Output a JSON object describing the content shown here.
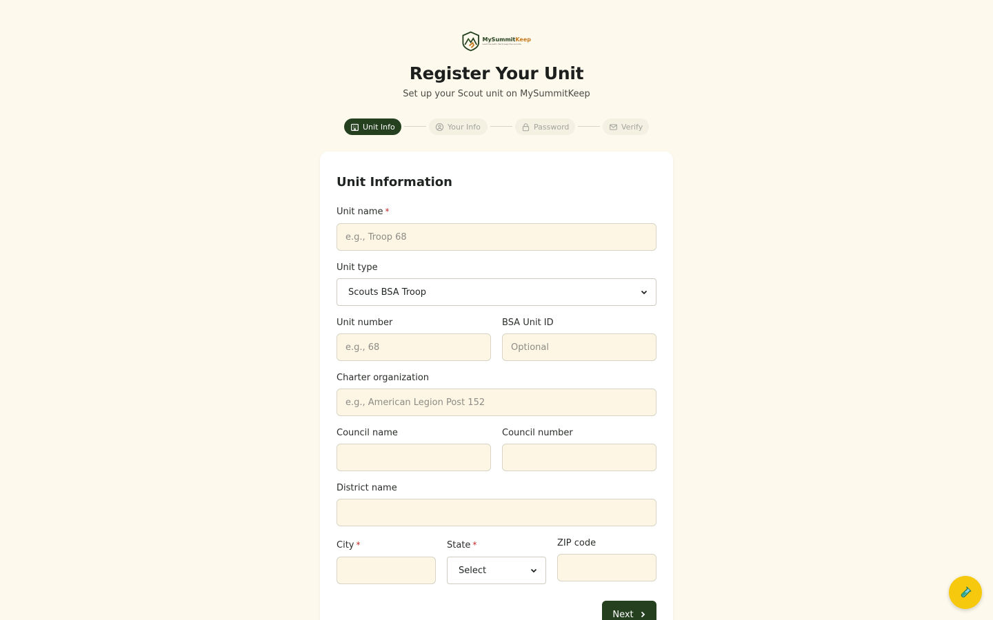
{
  "brand": {
    "name_part1": "MySummit",
    "name_part2": "Keep",
    "tagline": "Lead the path. We'll keep the records."
  },
  "header": {
    "title": "Register Your Unit",
    "subtitle": "Set up your Scout unit on MySummitKeep"
  },
  "steps": [
    {
      "label": "Unit Info",
      "icon": "building-icon",
      "state": "active"
    },
    {
      "label": "Your Info",
      "icon": "user-circle-icon",
      "state": "inactive"
    },
    {
      "label": "Password",
      "icon": "lock-icon",
      "state": "inactive"
    },
    {
      "label": "Verify",
      "icon": "mail-icon",
      "state": "inactive"
    }
  ],
  "form": {
    "section_title": "Unit Information",
    "unit_name": {
      "label": "Unit name",
      "required_mark": "*",
      "placeholder": "e.g., Troop 68",
      "value": ""
    },
    "unit_type": {
      "label": "Unit type",
      "selected": "Scouts BSA Troop"
    },
    "unit_number": {
      "label": "Unit number",
      "placeholder": "e.g., 68",
      "value": ""
    },
    "bsa_unit_id": {
      "label": "BSA Unit ID",
      "placeholder": "Optional",
      "value": ""
    },
    "charter_org": {
      "label": "Charter organization",
      "placeholder": "e.g., American Legion Post 152",
      "value": ""
    },
    "council_name": {
      "label": "Council name",
      "value": ""
    },
    "council_number": {
      "label": "Council number",
      "value": ""
    },
    "district_name": {
      "label": "District name",
      "value": ""
    },
    "city": {
      "label": "City",
      "required_mark": "*",
      "value": ""
    },
    "state": {
      "label": "State",
      "required_mark": "*",
      "selected": "Select"
    },
    "zip": {
      "label": "ZIP code",
      "value": ""
    },
    "next_label": "Next"
  },
  "colors": {
    "page_background": "#fdf9ec",
    "primary": "#24401f",
    "accent": "#c57a1f",
    "required": "#c62828",
    "fab": "#f6c90e"
  },
  "fab": {
    "icon": "test-tube-icon"
  }
}
